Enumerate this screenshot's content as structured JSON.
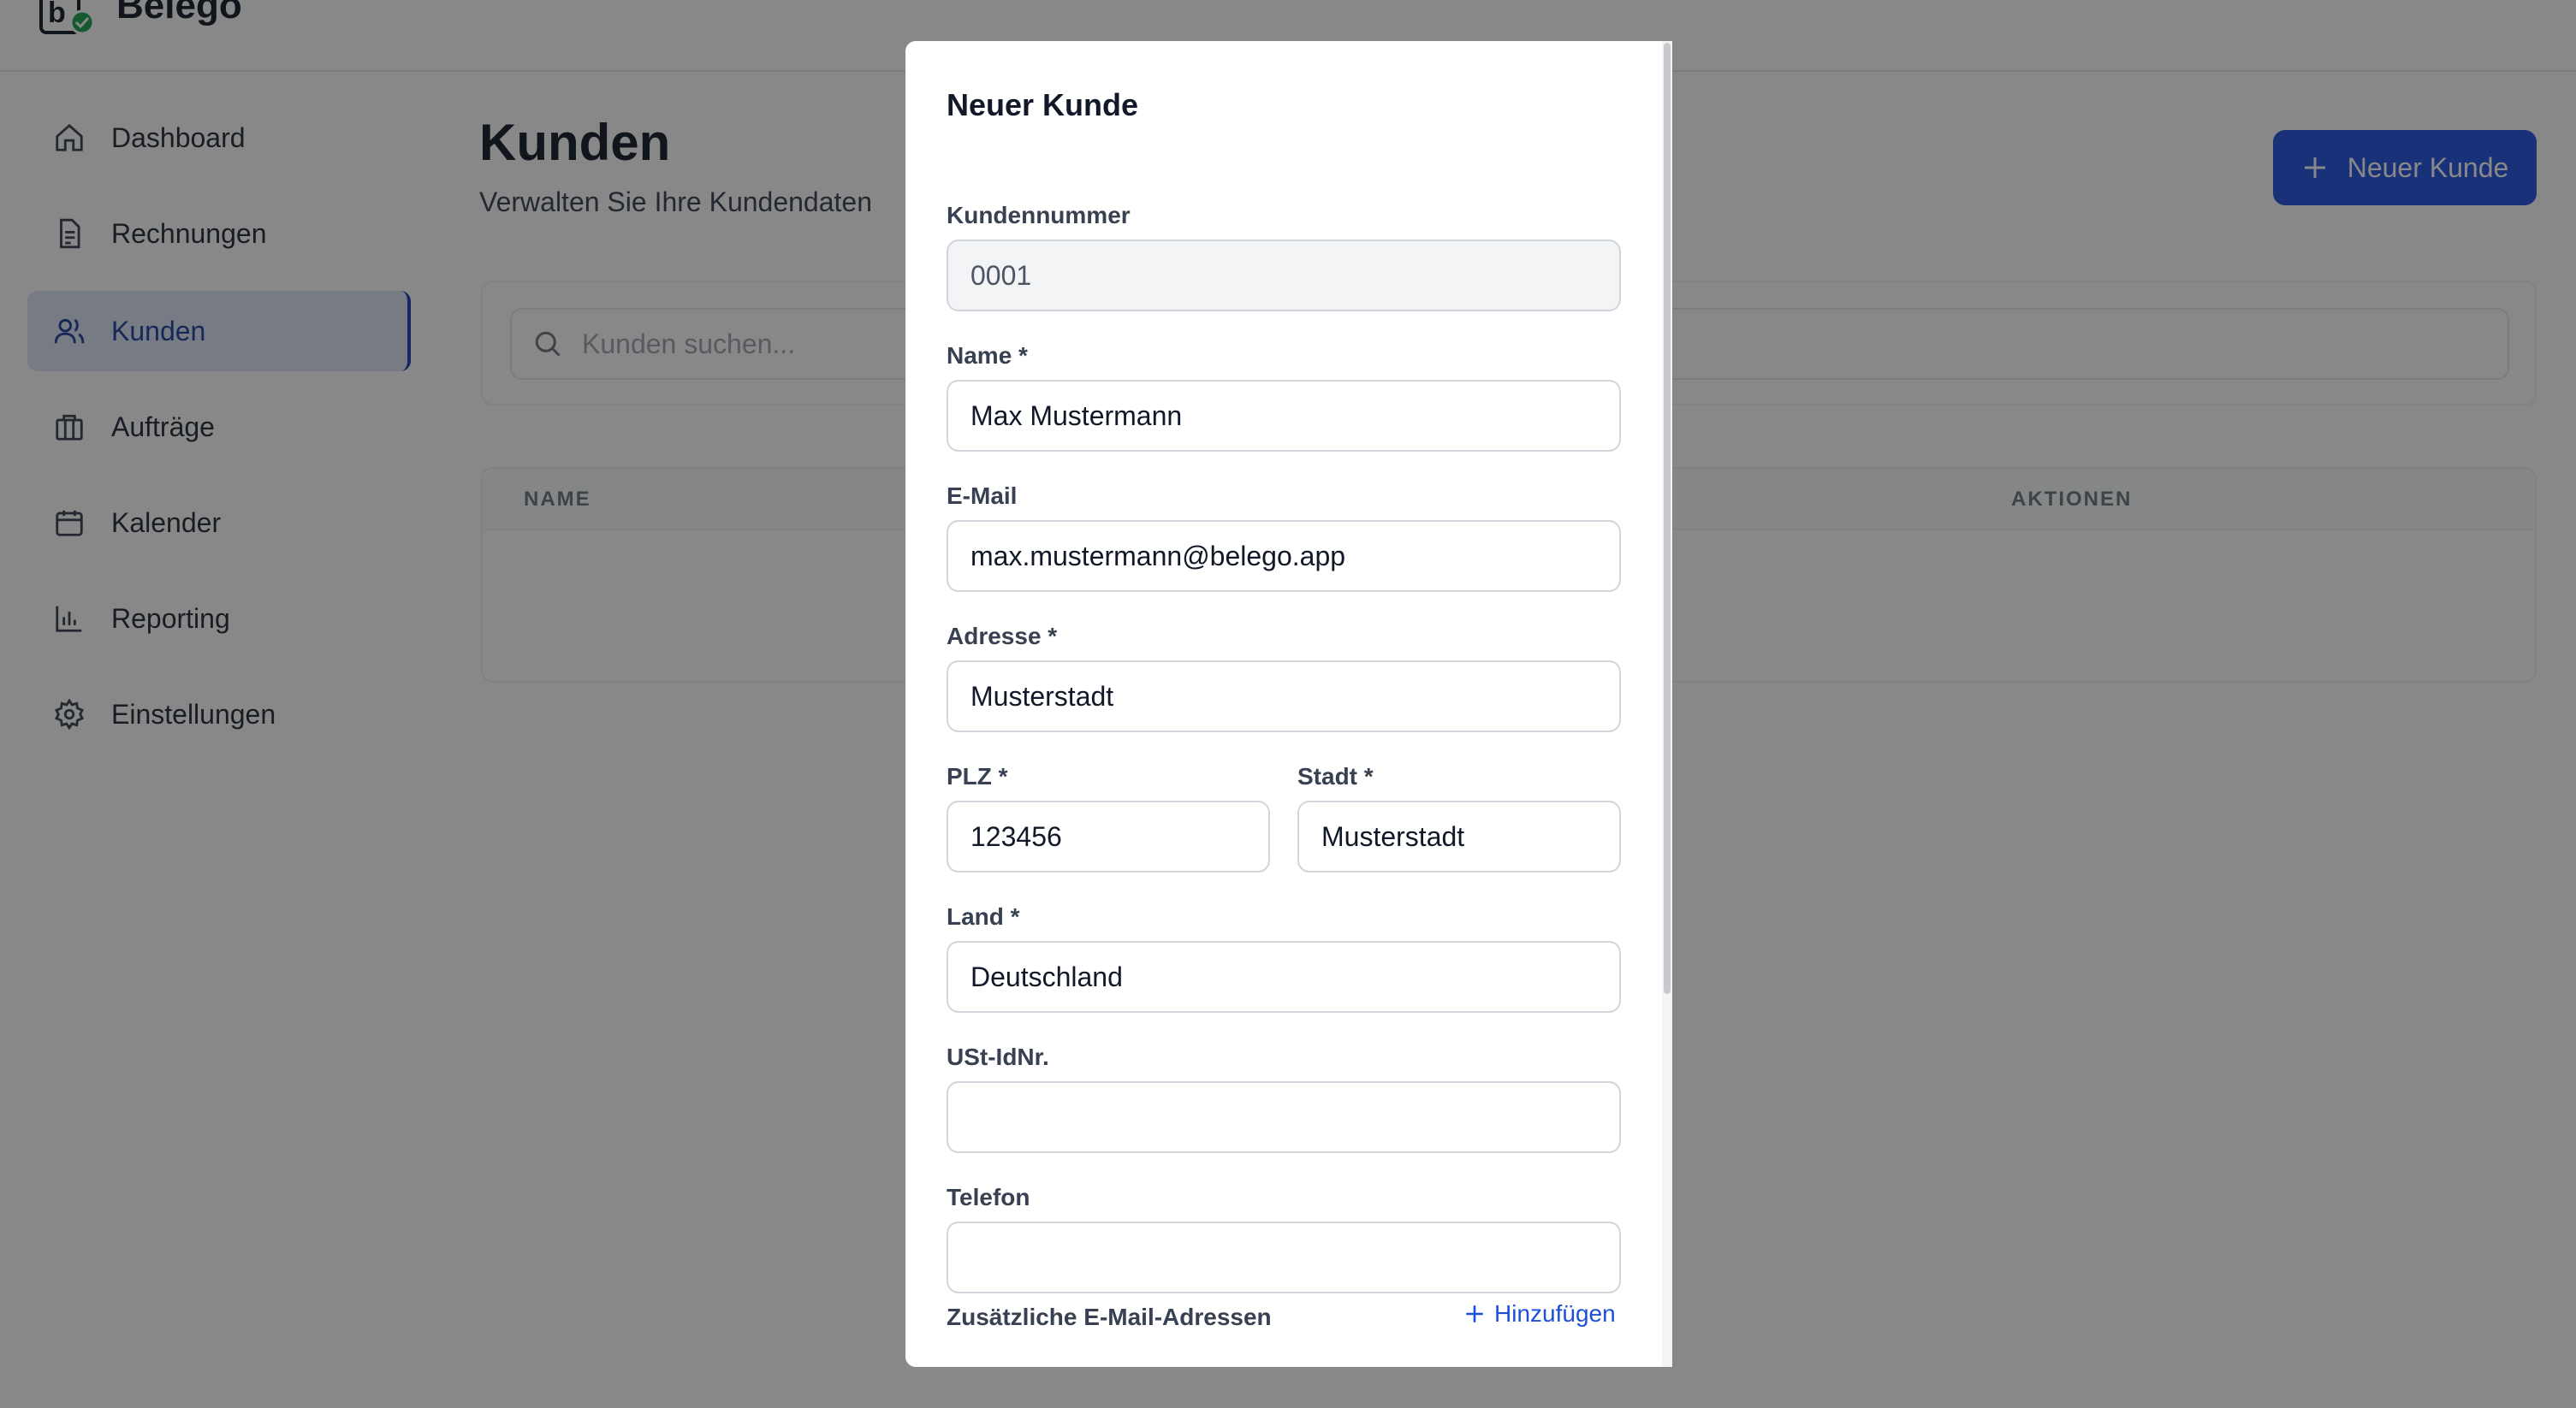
{
  "app": {
    "name": "Belego",
    "colors": {
      "accent": "#2050e0",
      "active_nav_bg": "#dbe4f7",
      "overlay": "rgba(17,17,17,0.5)"
    }
  },
  "sidebar": {
    "items": [
      {
        "label": "Dashboard",
        "icon": "home-icon",
        "active": false
      },
      {
        "label": "Rechnungen",
        "icon": "document-icon",
        "active": false
      },
      {
        "label": "Kunden",
        "icon": "users-icon",
        "active": true
      },
      {
        "label": "Aufträge",
        "icon": "briefcase-icon",
        "active": false
      },
      {
        "label": "Kalender",
        "icon": "calendar-icon",
        "active": false
      },
      {
        "label": "Reporting",
        "icon": "bar-chart-icon",
        "active": false
      },
      {
        "label": "Einstellungen",
        "icon": "gear-icon",
        "active": false
      }
    ]
  },
  "main": {
    "title": "Kunden",
    "subtitle": "Verwalten Sie Ihre Kundendaten",
    "new_button_label": "Neuer Kunde",
    "search_placeholder": "Kunden suchen...",
    "table": {
      "columns": [
        "NAME",
        "AKTIONEN"
      ]
    }
  },
  "modal": {
    "title": "Neuer Kunde",
    "fields": {
      "kundennummer": {
        "label": "Kundennummer",
        "value": "0001",
        "readonly": true
      },
      "name": {
        "label": "Name *",
        "value": "Max Mustermann"
      },
      "email": {
        "label": "E-Mail",
        "value": "max.mustermann@belego.app"
      },
      "adresse": {
        "label": "Adresse *",
        "value": "Musterstadt"
      },
      "plz": {
        "label": "PLZ *",
        "value": "123456"
      },
      "stadt": {
        "label": "Stadt *",
        "value": "Musterstadt"
      },
      "land": {
        "label": "Land *",
        "value": "Deutschland"
      },
      "ustid": {
        "label": "USt-IdNr.",
        "value": ""
      },
      "telefon": {
        "label": "Telefon",
        "value": ""
      }
    },
    "extra_emails_label": "Zusätzliche E-Mail-Adressen",
    "add_label": "Hinzufügen"
  }
}
